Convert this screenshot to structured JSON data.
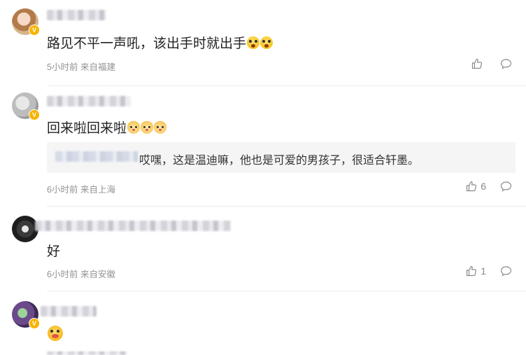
{
  "comments": [
    {
      "text": "路见不平一声吼，该出手时就出手",
      "emoji_icons": [
        "scared-face-icon",
        "scared-face-icon"
      ],
      "time": "5小时前",
      "source": "来自福建",
      "likes": ""
    },
    {
      "text": "回来啦回来啦",
      "emoji_icons": [
        "dog-face-icon",
        "dog-face-icon",
        "dog-face-icon"
      ],
      "reply_text": "哎嘿，这是温迪嘛，他也是可爱的男孩子，很适合轩墨。",
      "time": "6小时前",
      "source": "来自上海",
      "likes": "6"
    },
    {
      "text": "好",
      "time": "6小时前",
      "source": "来自安徽",
      "likes": "1"
    },
    {
      "emoji_icons": [
        "eating-face-icon"
      ]
    }
  ],
  "colors": {
    "verified_badge": "#f7b500",
    "meta_text": "#939393",
    "divider": "#ececec"
  }
}
